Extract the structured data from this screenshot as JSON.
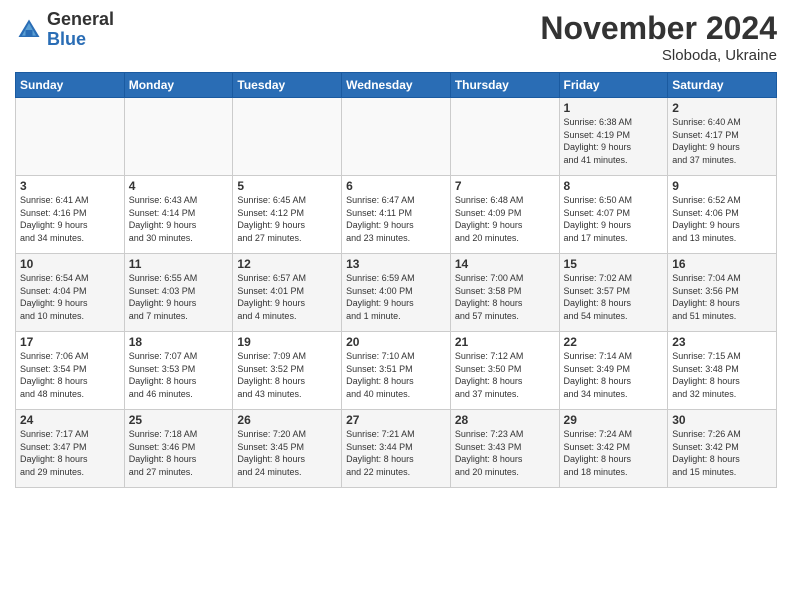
{
  "header": {
    "logo_general": "General",
    "logo_blue": "Blue",
    "month_title": "November 2024",
    "subtitle": "Sloboda, Ukraine"
  },
  "weekdays": [
    "Sunday",
    "Monday",
    "Tuesday",
    "Wednesday",
    "Thursday",
    "Friday",
    "Saturday"
  ],
  "weeks": [
    [
      {
        "day": "",
        "info": ""
      },
      {
        "day": "",
        "info": ""
      },
      {
        "day": "",
        "info": ""
      },
      {
        "day": "",
        "info": ""
      },
      {
        "day": "",
        "info": ""
      },
      {
        "day": "1",
        "info": "Sunrise: 6:38 AM\nSunset: 4:19 PM\nDaylight: 9 hours\nand 41 minutes."
      },
      {
        "day": "2",
        "info": "Sunrise: 6:40 AM\nSunset: 4:17 PM\nDaylight: 9 hours\nand 37 minutes."
      }
    ],
    [
      {
        "day": "3",
        "info": "Sunrise: 6:41 AM\nSunset: 4:16 PM\nDaylight: 9 hours\nand 34 minutes."
      },
      {
        "day": "4",
        "info": "Sunrise: 6:43 AM\nSunset: 4:14 PM\nDaylight: 9 hours\nand 30 minutes."
      },
      {
        "day": "5",
        "info": "Sunrise: 6:45 AM\nSunset: 4:12 PM\nDaylight: 9 hours\nand 27 minutes."
      },
      {
        "day": "6",
        "info": "Sunrise: 6:47 AM\nSunset: 4:11 PM\nDaylight: 9 hours\nand 23 minutes."
      },
      {
        "day": "7",
        "info": "Sunrise: 6:48 AM\nSunset: 4:09 PM\nDaylight: 9 hours\nand 20 minutes."
      },
      {
        "day": "8",
        "info": "Sunrise: 6:50 AM\nSunset: 4:07 PM\nDaylight: 9 hours\nand 17 minutes."
      },
      {
        "day": "9",
        "info": "Sunrise: 6:52 AM\nSunset: 4:06 PM\nDaylight: 9 hours\nand 13 minutes."
      }
    ],
    [
      {
        "day": "10",
        "info": "Sunrise: 6:54 AM\nSunset: 4:04 PM\nDaylight: 9 hours\nand 10 minutes."
      },
      {
        "day": "11",
        "info": "Sunrise: 6:55 AM\nSunset: 4:03 PM\nDaylight: 9 hours\nand 7 minutes."
      },
      {
        "day": "12",
        "info": "Sunrise: 6:57 AM\nSunset: 4:01 PM\nDaylight: 9 hours\nand 4 minutes."
      },
      {
        "day": "13",
        "info": "Sunrise: 6:59 AM\nSunset: 4:00 PM\nDaylight: 9 hours\nand 1 minute."
      },
      {
        "day": "14",
        "info": "Sunrise: 7:00 AM\nSunset: 3:58 PM\nDaylight: 8 hours\nand 57 minutes."
      },
      {
        "day": "15",
        "info": "Sunrise: 7:02 AM\nSunset: 3:57 PM\nDaylight: 8 hours\nand 54 minutes."
      },
      {
        "day": "16",
        "info": "Sunrise: 7:04 AM\nSunset: 3:56 PM\nDaylight: 8 hours\nand 51 minutes."
      }
    ],
    [
      {
        "day": "17",
        "info": "Sunrise: 7:06 AM\nSunset: 3:54 PM\nDaylight: 8 hours\nand 48 minutes."
      },
      {
        "day": "18",
        "info": "Sunrise: 7:07 AM\nSunset: 3:53 PM\nDaylight: 8 hours\nand 46 minutes."
      },
      {
        "day": "19",
        "info": "Sunrise: 7:09 AM\nSunset: 3:52 PM\nDaylight: 8 hours\nand 43 minutes."
      },
      {
        "day": "20",
        "info": "Sunrise: 7:10 AM\nSunset: 3:51 PM\nDaylight: 8 hours\nand 40 minutes."
      },
      {
        "day": "21",
        "info": "Sunrise: 7:12 AM\nSunset: 3:50 PM\nDaylight: 8 hours\nand 37 minutes."
      },
      {
        "day": "22",
        "info": "Sunrise: 7:14 AM\nSunset: 3:49 PM\nDaylight: 8 hours\nand 34 minutes."
      },
      {
        "day": "23",
        "info": "Sunrise: 7:15 AM\nSunset: 3:48 PM\nDaylight: 8 hours\nand 32 minutes."
      }
    ],
    [
      {
        "day": "24",
        "info": "Sunrise: 7:17 AM\nSunset: 3:47 PM\nDaylight: 8 hours\nand 29 minutes."
      },
      {
        "day": "25",
        "info": "Sunrise: 7:18 AM\nSunset: 3:46 PM\nDaylight: 8 hours\nand 27 minutes."
      },
      {
        "day": "26",
        "info": "Sunrise: 7:20 AM\nSunset: 3:45 PM\nDaylight: 8 hours\nand 24 minutes."
      },
      {
        "day": "27",
        "info": "Sunrise: 7:21 AM\nSunset: 3:44 PM\nDaylight: 8 hours\nand 22 minutes."
      },
      {
        "day": "28",
        "info": "Sunrise: 7:23 AM\nSunset: 3:43 PM\nDaylight: 8 hours\nand 20 minutes."
      },
      {
        "day": "29",
        "info": "Sunrise: 7:24 AM\nSunset: 3:42 PM\nDaylight: 8 hours\nand 18 minutes."
      },
      {
        "day": "30",
        "info": "Sunrise: 7:26 AM\nSunset: 3:42 PM\nDaylight: 8 hours\nand 15 minutes."
      }
    ]
  ]
}
